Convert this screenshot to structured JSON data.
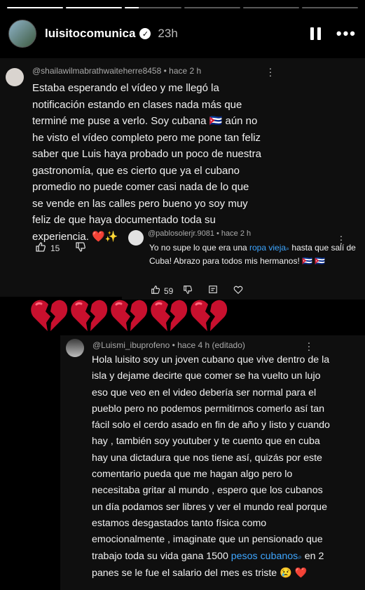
{
  "story": {
    "username": "luisitocomunica",
    "time": "23h",
    "progress": [
      1,
      1,
      0.25,
      0,
      0,
      0
    ]
  },
  "comment1": {
    "handle": "@shailawilmabrathwaiteherre8458",
    "time": "hace 2 h",
    "text": "Estaba esperando el vídeo y me llegó la notificación estando en clases nada más que terminé me puse a verlo. Soy cubana 🇨🇺 aún no he visto el vídeo completo pero me pone tan feliz saber que Luis haya probado un poco de nuestra gastronomía, que es cierto que ya el cubano promedio no puede comer casi nada de lo que se vende en las calles pero bueno yo soy muy feliz de que haya documentado toda su experiencia. ❤️✨",
    "likes": "15"
  },
  "reply1": {
    "handle": "@pablosolerjr.9081",
    "time": "hace 2 h",
    "text_before": "Yo no supe lo que era una ",
    "link": "ropa vieja",
    "text_after": " hasta que salí de Cuba! Abrazo para todos mis hermanos! 🇨🇺 🇨🇺",
    "likes": "59"
  },
  "hearts_count": 5,
  "comment2": {
    "handle": "@Luismi_ibuprofeno",
    "time": "hace 4 h (editado)",
    "text_before": "Hola luisito soy un joven cubano que vive dentro de la isla y dejame decirte que comer se ha vuelto un lujo eso que veo en el video debería ser normal para el pueblo pero no podemos permitirnos comerlo así tan fácil solo el cerdo asado en fin de año y listo y cuando hay , también soy youtuber  y te cuento que en cuba hay una dictadura que nos tiene así,  quizás por este comentario pueda que me hagan algo pero lo necesitaba gritar al mundo , espero que los cubanos un día podamos ser libres y ver el mundo real porque estamos desgastados tanto física como emocionalmente  , imaginate que un pensionado que trabajo toda su vida gana 1500 ",
    "link": "pesos cubanos",
    "text_after": "  en 2 panes se le fue el salario del mes es triste 😢 ❤️"
  }
}
